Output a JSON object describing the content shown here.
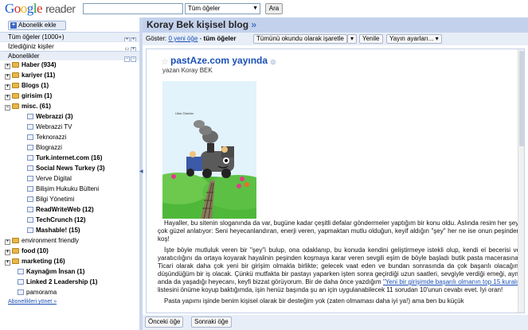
{
  "app": {
    "logo_google": "Google",
    "logo_reader": "reader"
  },
  "search": {
    "value": "",
    "scope": "Tüm öğeler",
    "button": "Ara"
  },
  "sidebar": {
    "subscribe_button": "Abonelik ekle",
    "all_items": "Tüm öğeler (1000+)",
    "following": "İzlediğiniz kişiler",
    "subscriptions_header": "Abonelikler",
    "manage_link": "Abonelikleri yönet »",
    "tree": [
      {
        "label": "Haber (934)",
        "type": "folder",
        "toggle": "+",
        "bold": true
      },
      {
        "label": "kariyer (11)",
        "type": "folder",
        "toggle": "+",
        "bold": true
      },
      {
        "label": "Blogs (1)",
        "type": "folder",
        "toggle": "+",
        "bold": true
      },
      {
        "label": "girisim (1)",
        "type": "folder",
        "toggle": "+",
        "bold": true
      },
      {
        "label": "misc. (61)",
        "type": "folder",
        "toggle": "−",
        "bold": true
      },
      {
        "label": "Webrazzi (3)",
        "type": "feed",
        "bold": true
      },
      {
        "label": "Webrazzi TV",
        "type": "feed",
        "bold": false
      },
      {
        "label": "Teknorazzi",
        "type": "feed",
        "bold": false
      },
      {
        "label": "Blograzzi",
        "type": "feed",
        "bold": false
      },
      {
        "label": "Turk.internet.com (16)",
        "type": "feed",
        "bold": true
      },
      {
        "label": "Social News Turkey (3)",
        "type": "feed",
        "bold": true
      },
      {
        "label": "Verve Digital",
        "type": "feed",
        "bold": false
      },
      {
        "label": "Bilişim Hukuku Bülteni",
        "type": "feed",
        "bold": false
      },
      {
        "label": "Bilgi Yönetimi",
        "type": "feed",
        "bold": false
      },
      {
        "label": "ReadWriteWeb (12)",
        "type": "feed",
        "bold": true
      },
      {
        "label": "TechCrunch (12)",
        "type": "feed",
        "bold": true
      },
      {
        "label": "Mashable! (15)",
        "type": "feed",
        "bold": true
      },
      {
        "label": "environment friendly",
        "type": "folder",
        "toggle": "+",
        "bold": false
      },
      {
        "label": "food (10)",
        "type": "folder",
        "toggle": "+",
        "bold": true
      },
      {
        "label": "marketing (16)",
        "type": "folder",
        "toggle": "+",
        "bold": true
      },
      {
        "label": "Kaynağım İnsan (1)",
        "type": "feed",
        "bold": true
      },
      {
        "label": "Linked 2 Leadership (1)",
        "type": "feed",
        "bold": true
      },
      {
        "label": "pamorama",
        "type": "feed",
        "bold": false
      }
    ]
  },
  "stream": {
    "title": "Koray Bek kişisel blog",
    "feed_link": "»",
    "show_label": "Göster:",
    "new_items": "0 yeni öğe",
    "sep": "-",
    "all_items": "tüm öğeler",
    "mark_all_read": "Tümünü okundu olarak işaretle",
    "refresh": "Yenile",
    "feed_settings": "Yayın ayarları..."
  },
  "entry": {
    "title": "pastAze.com yayında",
    "author": "yazan Koray BEK",
    "illustration_caption": "Ufuk Öztekin",
    "paragraphs": [
      "Hayaller, bu sitenin sloganında da var, bugüne kadar çeşitli defalar göndermeler yaptığım bir konu oldu. Aslında resim her şeyi çok güzel anlatıyor: Seni heyecanlandıran, enerji veren, yapmaktan mutlu olduğun, keyif aldığın \"şey\" her ne ise onun peşinden koş!",
      "İşte böyle mutluluk veren bir \"şey\"i bulup, ona odaklanıp, bu konuda kendini geliştirmeye istekli olup, kendi el becerisi ve yaratıcılığını da ortaya koyarak hayalinin peşinden koşmaya karar veren sevgili eşim de böyle başladı butik pasta macerasına. Ticari olarak daha çok yeni bir girişim olmakla birlikte; gelecek vaat eden ve bundan sonrasında da çok başarılı olacağını düşündüğüm bir iş olacak. Çünkü mutfakta bir pastayı yaparken işten sonra geçirdiği uzun saatleri, sevgiyle verdiği emeği, aynı anda da yaşadığı heyecanı, keyfi bizzat görüyorum. Bir de daha önce yazdığım",
      "listesini önüme koyup baktığımda, işin henüz başında şu an için uygulanabilecek 11 sorudan 10'unun cevabı evet. İyi oran!",
      "Pasta yapımı işinde benim kişisel olarak bir desteğim yok (zaten olmaması daha iyi ya!) ama ben bu küçük"
    ],
    "inline_link": "\"Yeni bir girişimde başarılı olmanın top 15 kuralı\""
  },
  "footer": {
    "prev": "Önceki öğe",
    "next": "Sonraki öğe"
  },
  "colors": {
    "accent": "#1a4fb5",
    "header_bg": "#c3d1ec",
    "panel_bg": "#e8eef7"
  }
}
